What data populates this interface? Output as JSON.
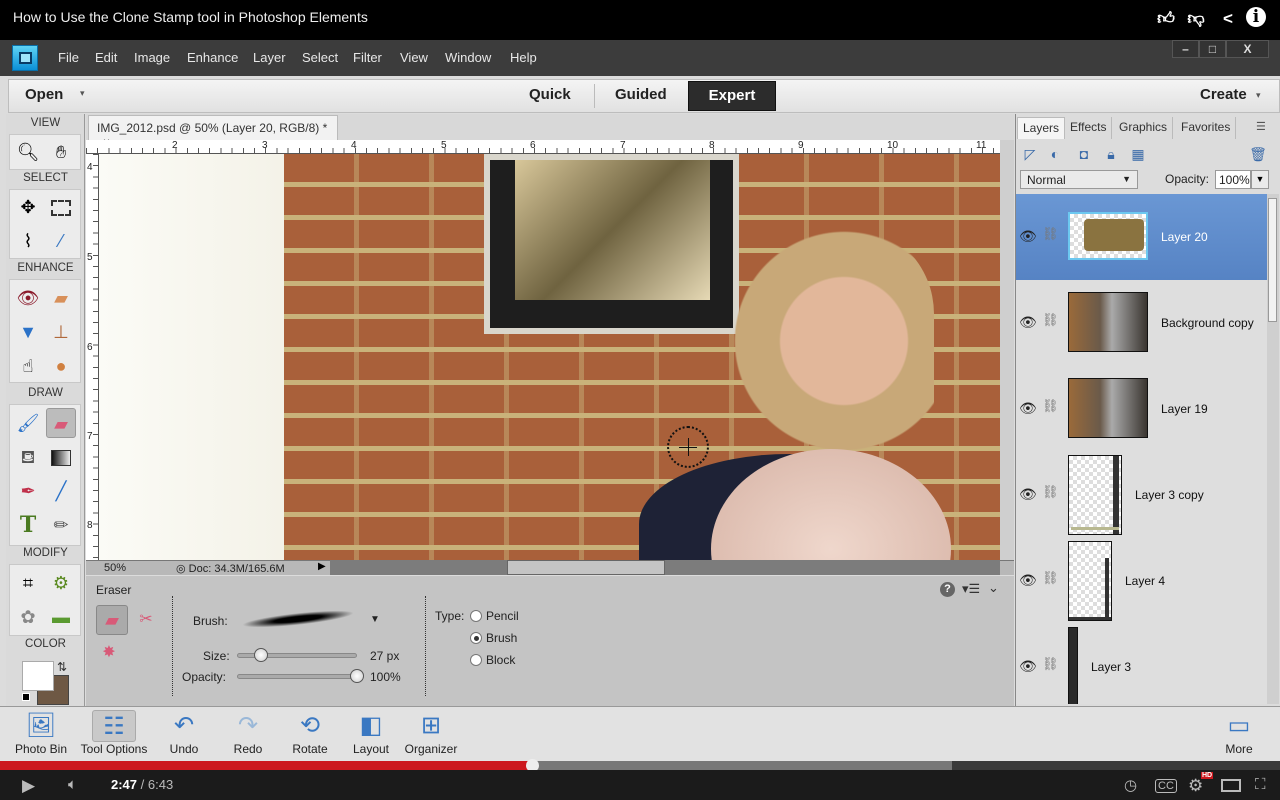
{
  "video": {
    "title": "How to Use the Clone Stamp tool in Photoshop Elements",
    "top_icons": [
      "thumbs-up-icon",
      "thumbs-down-icon",
      "share-icon",
      "info-icon"
    ],
    "current_time": "2:47",
    "duration": "6:43",
    "time_separator": "/",
    "played_fraction": 0.416,
    "hd_badge": "HD"
  },
  "app": {
    "menu": [
      "File",
      "Edit",
      "Image",
      "Enhance",
      "Layer",
      "Select",
      "Filter",
      "View",
      "Window",
      "Help"
    ],
    "window_controls": {
      "minimize": "–",
      "restore": "□",
      "close": "X"
    },
    "open_label": "Open",
    "modes": [
      "Quick",
      "Guided",
      "Expert"
    ],
    "active_mode": "Expert",
    "create_label": "Create"
  },
  "toolbox": {
    "sections": [
      {
        "title": "VIEW",
        "tools": [
          "zoom",
          "hand"
        ]
      },
      {
        "title": "SELECT",
        "tools": [
          "move",
          "rectangular-marquee",
          "lasso",
          "quick-selection"
        ]
      },
      {
        "title": "ENHANCE",
        "tools": [
          "red-eye",
          "spot-healing",
          "sponge",
          "clone-stamp",
          "smudge",
          "blur"
        ]
      },
      {
        "title": "DRAW",
        "tools": [
          "brush",
          "eraser",
          "paint-bucket",
          "gradient",
          "color-picker",
          "line",
          "type",
          "pencil"
        ]
      },
      {
        "title": "MODIFY",
        "tools": [
          "crop",
          "recompose",
          "cookie-cutter",
          "straighten"
        ]
      },
      {
        "title": "COLOR",
        "tools": []
      }
    ],
    "active_tool": "eraser",
    "foreground_color": "#ffffff",
    "background_color": "#6e5844"
  },
  "document": {
    "tab_title": "IMG_2012.psd @ 50% (Layer 20, RGB/8) *",
    "close": "×",
    "ruler_top": [
      "2",
      "3",
      "4",
      "5",
      "6",
      "7",
      "8",
      "9",
      "10",
      "11"
    ],
    "ruler_left": [
      "4",
      "5",
      "6",
      "7",
      "8"
    ],
    "zoom": "50%",
    "doc_info": "Doc: 34.3M/165.6M"
  },
  "tool_options": {
    "tool_name": "Eraser",
    "brush_label": "Brush:",
    "size_label": "Size:",
    "size_value": "27 px",
    "size_fraction": 0.2,
    "opacity_label": "Opacity:",
    "opacity_value": "100%",
    "opacity_fraction": 1.0,
    "type_label": "Type:",
    "types": [
      "Pencil",
      "Brush",
      "Block"
    ],
    "selected_type": "Brush"
  },
  "panel": {
    "tabs": [
      "Layers",
      "Effects",
      "Graphics",
      "Favorites"
    ],
    "active_tab": "Layers",
    "blend_mode": "Normal",
    "opacity_label": "Opacity:",
    "opacity_value": "100%",
    "layers": [
      {
        "name": "Layer 20",
        "selected": true
      },
      {
        "name": "Background copy",
        "selected": false
      },
      {
        "name": "Layer 19",
        "selected": false
      },
      {
        "name": "Layer 3 copy",
        "selected": false
      },
      {
        "name": "Layer 4",
        "selected": false
      },
      {
        "name": "Layer 3",
        "selected": false
      }
    ]
  },
  "taskbar": {
    "items": [
      "Photo Bin",
      "Tool Options",
      "Undo",
      "Redo",
      "Rotate",
      "Layout",
      "Organizer"
    ],
    "more": "More"
  }
}
